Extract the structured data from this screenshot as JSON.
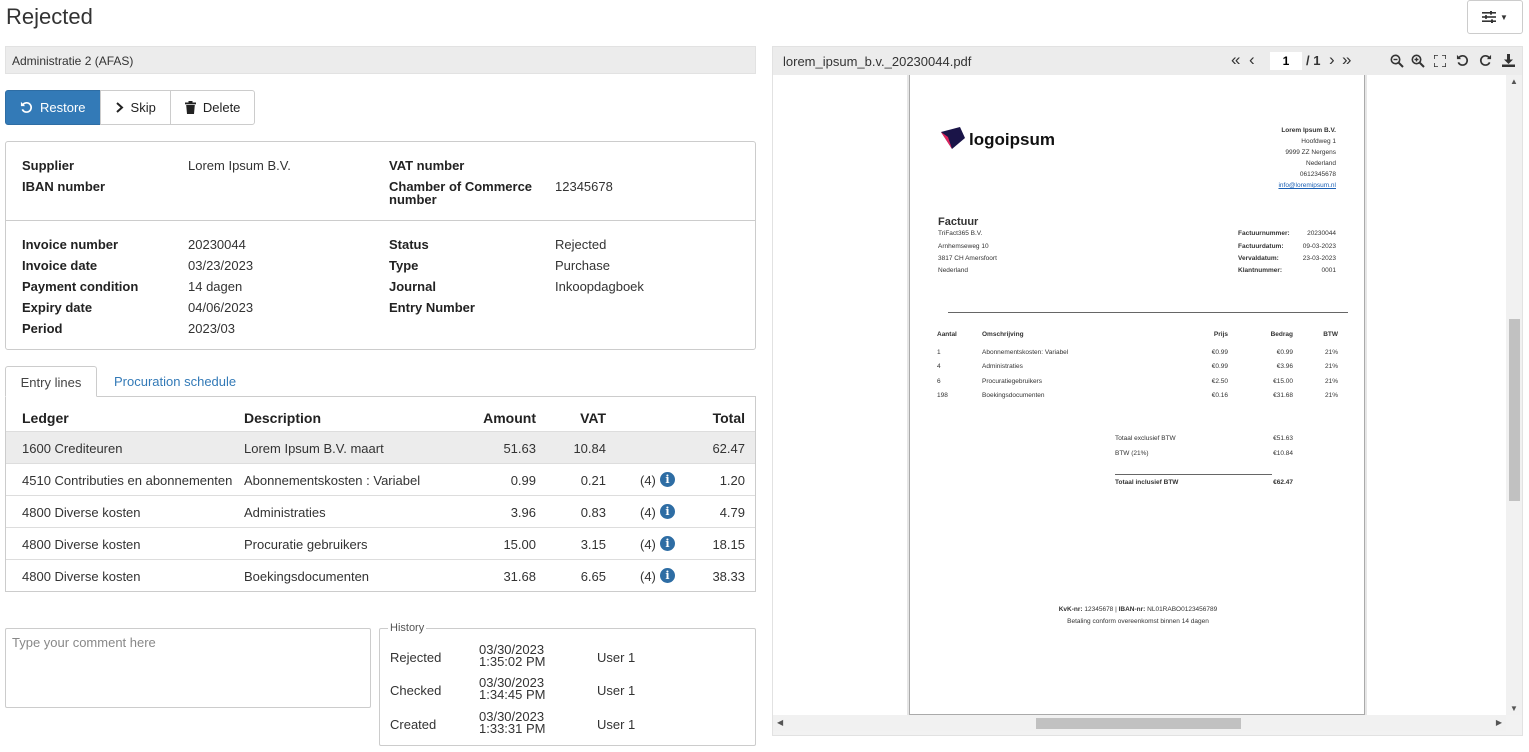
{
  "page": {
    "title": "Rejected"
  },
  "admin": {
    "name": "Administratie 2 (AFAS)"
  },
  "toolbar": {
    "restore": "Restore",
    "skip": "Skip",
    "delete": "Delete"
  },
  "supplier_info": {
    "supplier_label": "Supplier",
    "supplier_value": "Lorem Ipsum B.V.",
    "iban_label": "IBAN number",
    "iban_value": "",
    "vat_label": "VAT number",
    "vat_value": "",
    "coc_label": "Chamber of Commerce number",
    "coc_value": "12345678"
  },
  "invoice_info": {
    "invoice_number_label": "Invoice number",
    "invoice_number": "20230044",
    "invoice_date_label": "Invoice date",
    "invoice_date": "03/23/2023",
    "payment_condition_label": "Payment condition",
    "payment_condition": "14 dagen",
    "expiry_date_label": "Expiry date",
    "expiry_date": "04/06/2023",
    "period_label": "Period",
    "period": "2023/03",
    "status_label": "Status",
    "status": "Rejected",
    "type_label": "Type",
    "type": "Purchase",
    "journal_label": "Journal",
    "journal": "Inkoopdagboek",
    "entry_number_label": "Entry Number",
    "entry_number": ""
  },
  "tabs": {
    "entry_lines": "Entry lines",
    "procuration": "Procuration schedule"
  },
  "entry_table": {
    "headers": {
      "ledger": "Ledger",
      "description": "Description",
      "amount": "Amount",
      "vat": "VAT",
      "total": "Total"
    },
    "rows": [
      {
        "ledger": "1600 Crediteuren",
        "description": "Lorem Ipsum B.V. maart",
        "amount": "51.63",
        "vat": "10.84",
        "vat_code": "",
        "total": "62.47"
      },
      {
        "ledger": "4510 Contributies en abonnementen",
        "description": "Abonnementskosten : Variabel",
        "amount": "0.99",
        "vat": "0.21",
        "vat_code": "(4)",
        "total": "1.20"
      },
      {
        "ledger": "4800 Diverse kosten",
        "description": "Administraties",
        "amount": "3.96",
        "vat": "0.83",
        "vat_code": "(4)",
        "total": "4.79"
      },
      {
        "ledger": "4800 Diverse kosten",
        "description": "Procuratie gebruikers",
        "amount": "15.00",
        "vat": "3.15",
        "vat_code": "(4)",
        "total": "18.15"
      },
      {
        "ledger": "4800 Diverse kosten",
        "description": "Boekingsdocumenten",
        "amount": "31.68",
        "vat": "6.65",
        "vat_code": "(4)",
        "total": "38.33"
      }
    ]
  },
  "comment": {
    "placeholder": "Type your comment here"
  },
  "history": {
    "legend": "History",
    "items": [
      {
        "action": "Rejected",
        "date": "03/30/2023 1:35:02 PM",
        "user": "User 1"
      },
      {
        "action": "Checked",
        "date": "03/30/2023 1:34:45 PM",
        "user": "User 1"
      },
      {
        "action": "Created",
        "date": "03/30/2023 1:33:31 PM",
        "user": "User 1"
      }
    ]
  },
  "pdf": {
    "filename": "lorem_ipsum_b.v._20230044.pdf",
    "current_page": "1",
    "total_pages": "/ 1",
    "doc": {
      "logo_text": "logoipsum",
      "sender": [
        "Lorem Ipsum B.V.",
        "Hoofdweg 1",
        "9999 ZZ  Nergens",
        "Nederland",
        "0612345678",
        "info@loremipsum.nl"
      ],
      "heading": "Factuur",
      "recipient": [
        "TriFact365 B.V.",
        "Arnhemseweg 10",
        "3817 CH  Amersfoort",
        "Nederland"
      ],
      "meta": [
        {
          "label": "Factuurnummer:",
          "value": "20230044"
        },
        {
          "label": "Factuurdatum:",
          "value": "09-03-2023"
        },
        {
          "label": "Vervaldatum:",
          "value": "23-03-2023"
        },
        {
          "label": "Klantnummer:",
          "value": "0001"
        }
      ],
      "line_headers": {
        "qty": "Aantal",
        "desc": "Omschrijving",
        "price": "Prijs",
        "amount": "Bedrag",
        "vat": "BTW"
      },
      "lines": [
        {
          "qty": "1",
          "desc": "Abonnementskosten: Variabel",
          "price": "€0.99",
          "amount": "€0.99",
          "vat": "21%"
        },
        {
          "qty": "4",
          "desc": "Administraties",
          "price": "€0.99",
          "amount": "€3.96",
          "vat": "21%"
        },
        {
          "qty": "6",
          "desc": "Procuratiegebruikers",
          "price": "€2.50",
          "amount": "€15.00",
          "vat": "21%"
        },
        {
          "qty": "198",
          "desc": "Boekingsdocumenten",
          "price": "€0.16",
          "amount": "€31.68",
          "vat": "21%"
        }
      ],
      "totals": [
        {
          "label": "Totaal exclusief BTW",
          "value": "€51.63"
        },
        {
          "label": "BTW (21%)",
          "value": "€10.84"
        },
        {
          "label": "Totaal inclusief BTW",
          "value": "€62.47"
        }
      ],
      "footer_kvk_label": "KvK-nr:",
      "footer_kvk": "12345678",
      "footer_iban_label": "IBAN-nr:",
      "footer_iban": "NL01RABO0123456789",
      "footer_payment": "Betaling conform overeenkomst binnen 14 dagen"
    }
  }
}
